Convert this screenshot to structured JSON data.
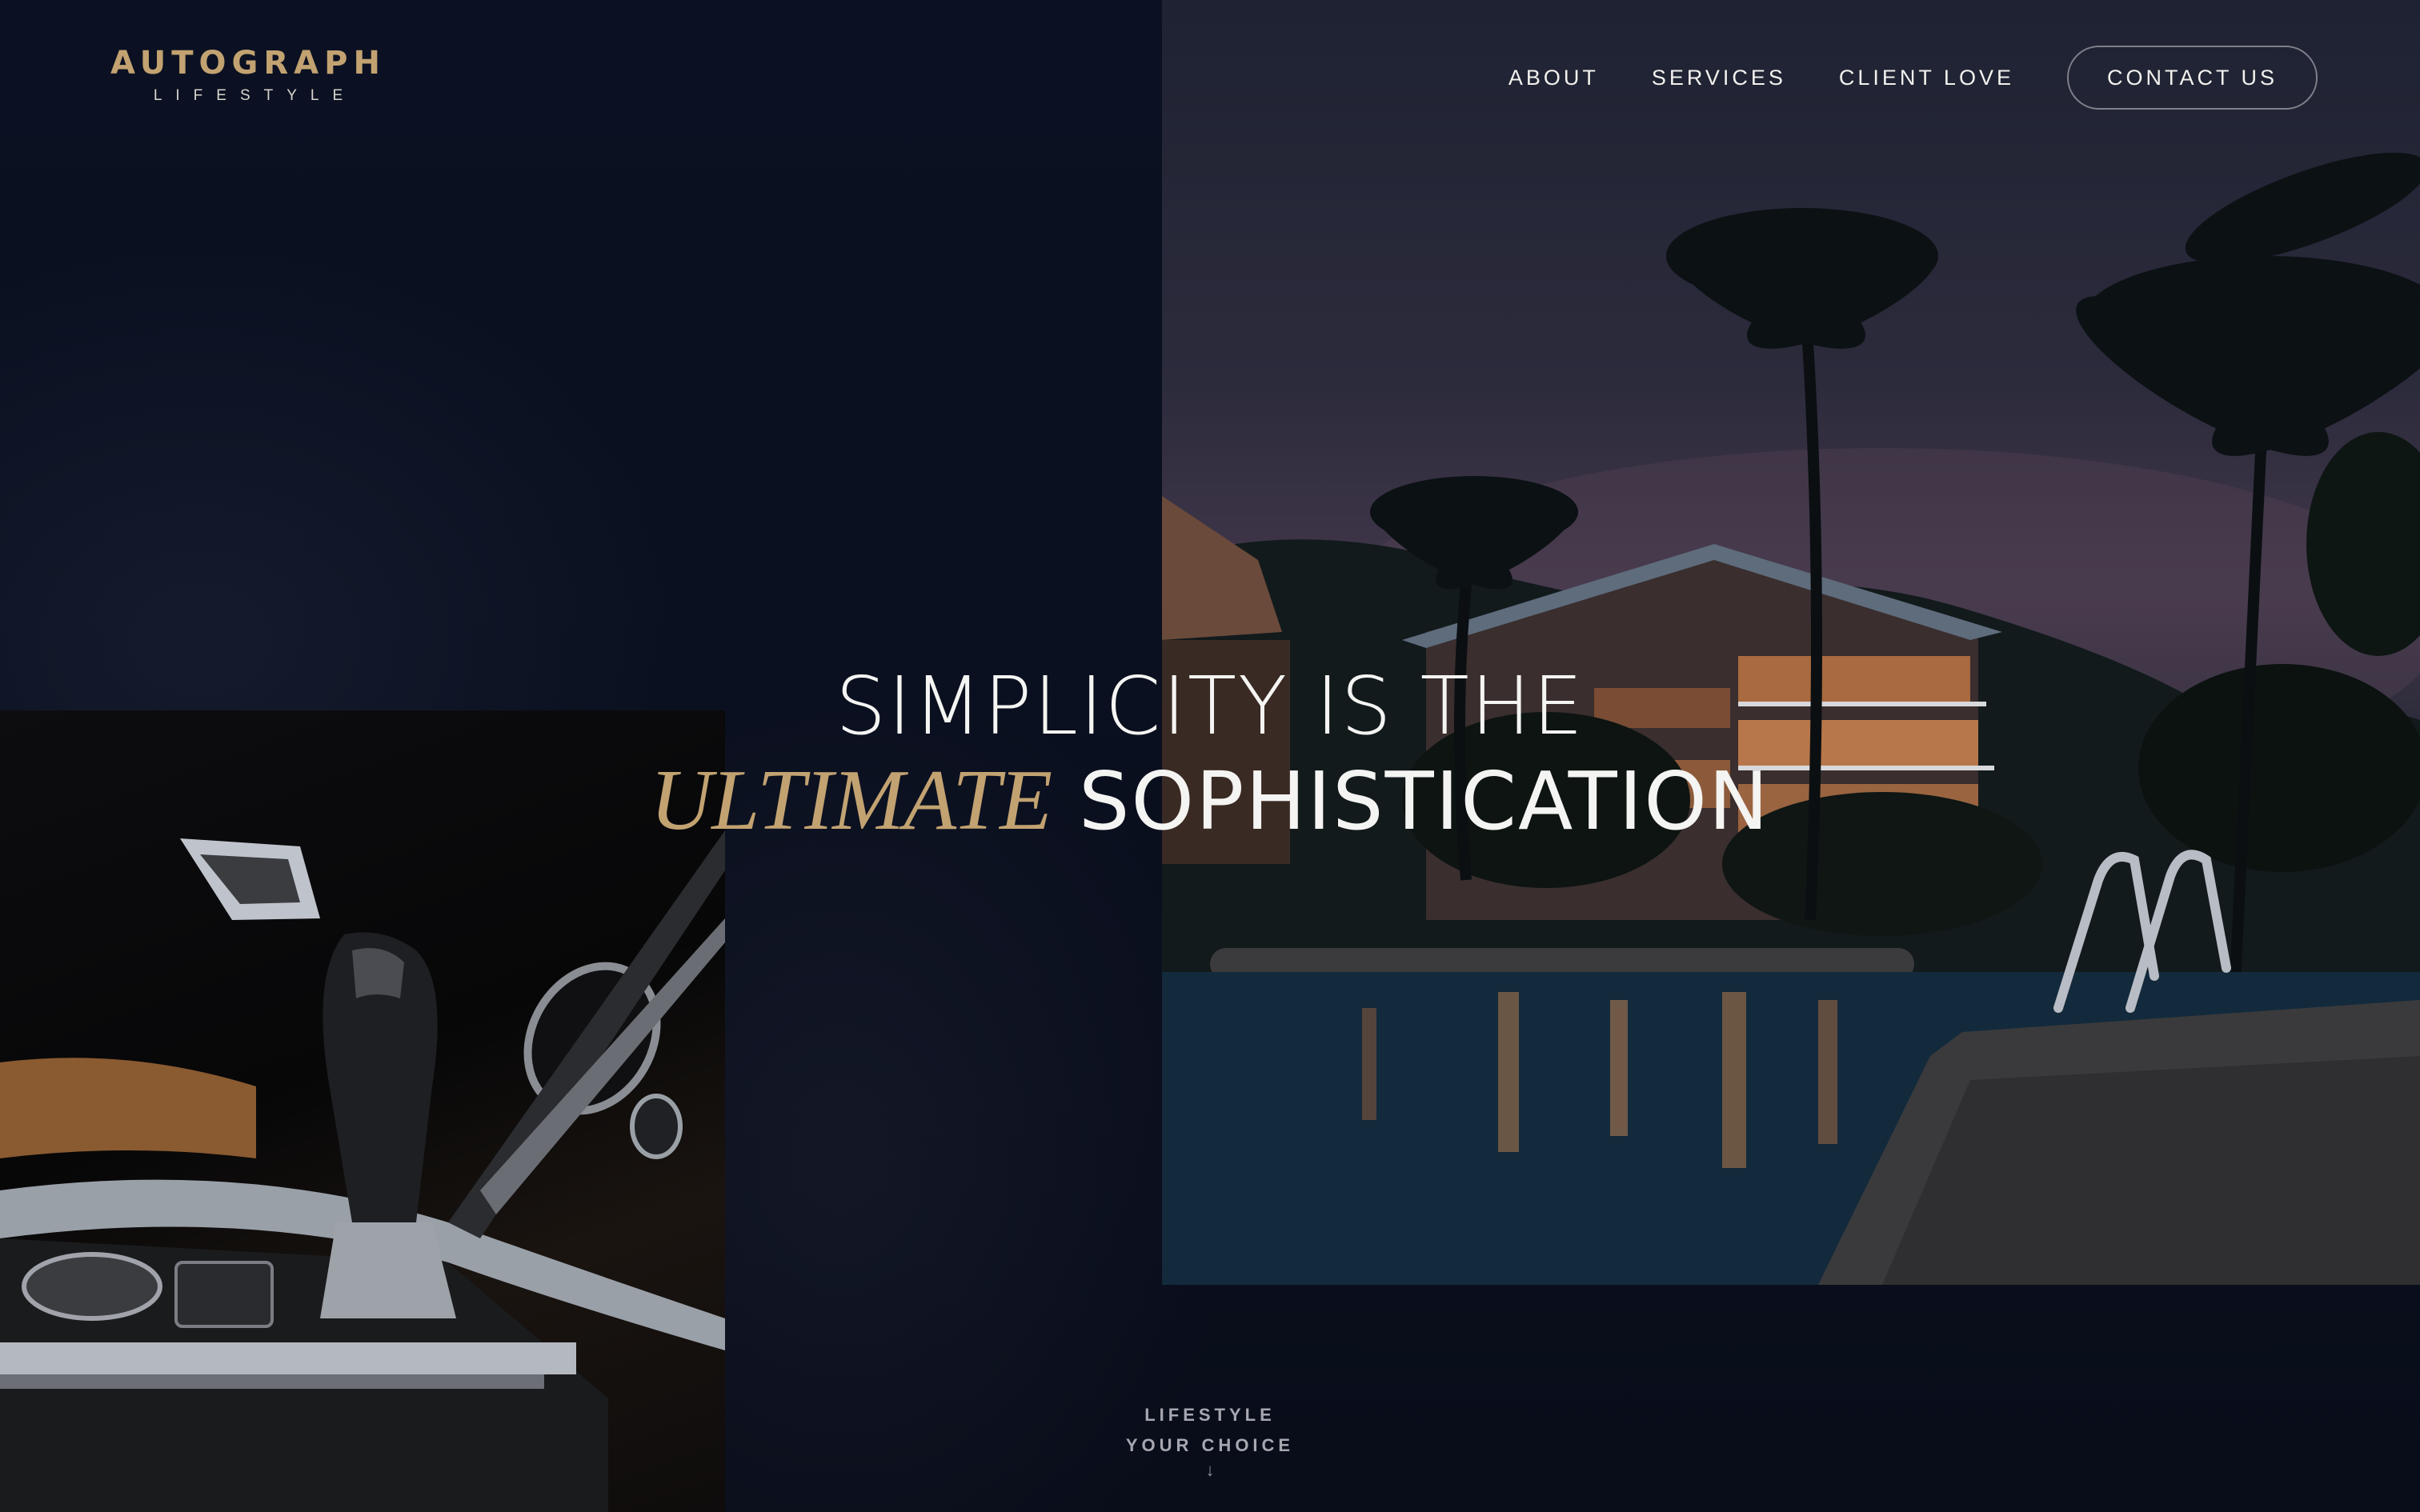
{
  "header": {
    "logo_main": "AUTOGRAPH",
    "logo_sub": "LIFESTYLE",
    "nav": {
      "about": "ABOUT",
      "services": "SERVICES",
      "client_love": "CLIENT LOVE",
      "contact": "CONTACT US"
    }
  },
  "hero": {
    "line1": "SIMPLICITY IS THE",
    "line2_accent": "ULTIMATE",
    "line2_rest": "SOPHISTICATION"
  },
  "scroll_cue": {
    "line1": "LIFESTYLE",
    "line2": "YOUR CHOICE",
    "arrow": "↓"
  },
  "images": {
    "resort": "resort-pool-night-photo",
    "car": "car-gear-shifter-photo"
  },
  "colors": {
    "background": "#0b1020",
    "accent_gold": "#c2a271",
    "text_light": "#f4f4f2"
  }
}
